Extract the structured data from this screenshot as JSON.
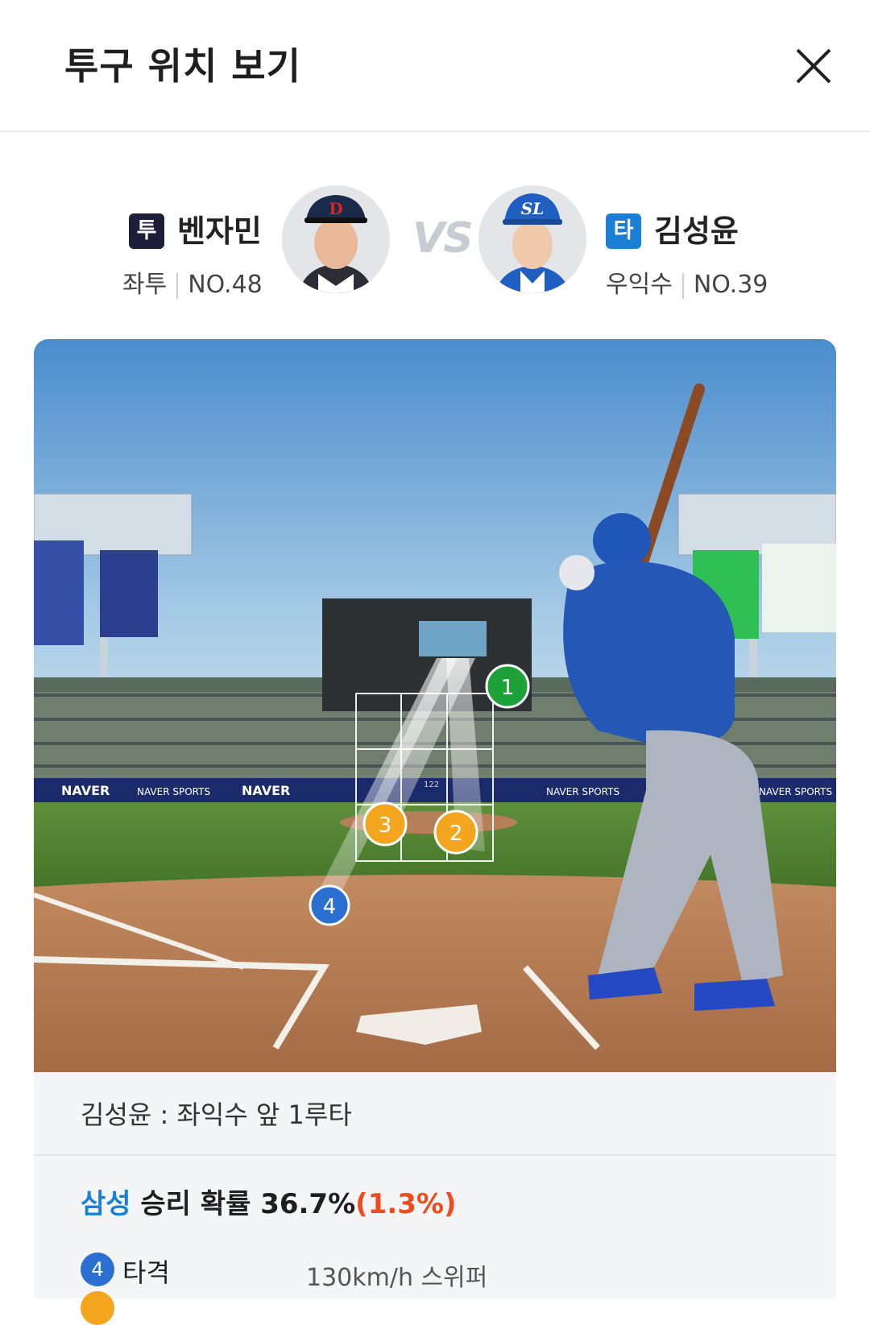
{
  "header": {
    "title": "투구 위치 보기"
  },
  "pitcher": {
    "badge": "투",
    "name": "벤자민",
    "hand": "좌투",
    "number": "NO.48",
    "badge_color": "#1d1f3a",
    "cap_color": "#1a2a4a"
  },
  "batter": {
    "badge": "타",
    "name": "김성윤",
    "position": "우익수",
    "number": "NO.39",
    "badge_color": "#1b7fd6",
    "cap_color": "#1f5fbf"
  },
  "vs_label": "VS",
  "stadium": {
    "pitches": [
      {
        "label": "1",
        "color": "#1fa13a"
      },
      {
        "label": "2",
        "color": "#f3a51e"
      },
      {
        "label": "3",
        "color": "#f3a51e"
      },
      {
        "label": "4",
        "color": "#2b6fd0"
      }
    ],
    "zone_center_label": "122",
    "boards": [
      "NAVER",
      "NAVER SPORTS",
      "NAVER",
      "NAVER SPORTS",
      "NAVER SPORTS"
    ]
  },
  "result": {
    "play": "김성윤 : 좌익수 앞 1루타"
  },
  "win_prob": {
    "team": "삼성",
    "text": " 승리 확률 36.7%",
    "delta": "(1.3%)"
  },
  "pitch_list": [
    {
      "num": "4",
      "result": "타격",
      "speed": "130km/h  스위퍼"
    }
  ]
}
